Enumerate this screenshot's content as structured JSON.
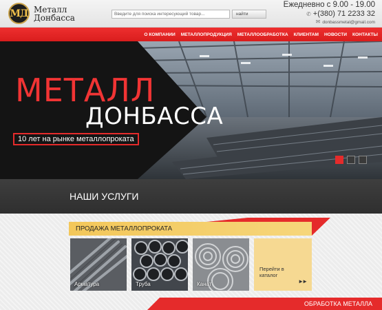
{
  "header": {
    "logo_mark": "МД",
    "logo_line1": "Металл",
    "logo_line2": "Донбасса",
    "search_placeholder": "Введите для поиска интересующий товар...",
    "search_button": "найти",
    "hours": "Ежедневно с 9.00 - 19.00",
    "phone": "+(380) 71 2233 32",
    "email": "donbassmetal@gmail.com",
    "phone_icon": "phone-icon",
    "email_icon": "mail-icon"
  },
  "nav": {
    "items": [
      "О КОМПАНИИ",
      "МЕТАЛЛОПРОДУКЦИЯ",
      "МЕТАЛЛООБРАБОТКА",
      "КЛИЕНТАМ",
      "НОВОСТИ",
      "КОНТАКТЫ"
    ]
  },
  "hero": {
    "title_line1": "МЕТАЛЛ",
    "title_line2": "ДОНБАССА",
    "subtitle": "10 лет на рынке металлопроката",
    "slides_count": 3,
    "active_slide": 1
  },
  "services": {
    "title": "НАШИ УСЛУГИ",
    "section1": "ПРОДАЖА МЕТАЛЛОПРОКАТА",
    "cards": [
      "Арматура",
      "Труба",
      "Канат"
    ],
    "catalog_link": "Перейти в каталог",
    "catalog_arrow": "►►",
    "section2": "ОБРАБОТКА МЕТАЛЛА"
  },
  "colors": {
    "accent_red": "#e52b2b",
    "accent_yellow": "#f3c75a",
    "dark": "#333333"
  }
}
